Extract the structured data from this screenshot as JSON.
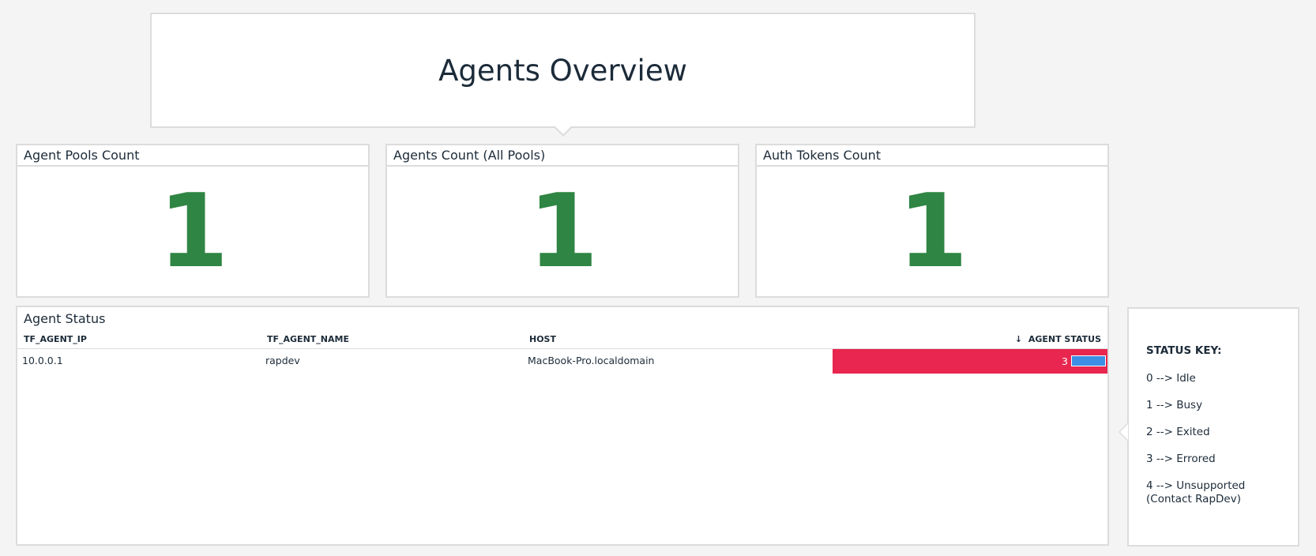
{
  "note": {
    "title": "Agents Overview"
  },
  "widgets": [
    {
      "title": "Agent Pools Count",
      "value": "1"
    },
    {
      "title": "Agents Count (All Pools)",
      "value": "1"
    },
    {
      "title": "Auth Tokens Count",
      "value": "1"
    }
  ],
  "agent_status": {
    "title": "Agent Status",
    "columns": [
      "TF_AGENT_IP",
      "TF_AGENT_NAME",
      "HOST",
      "AGENT STATUS"
    ],
    "sort_indicator": "↓",
    "rows": [
      {
        "ip": "10.0.0.1",
        "name": "rapdev",
        "host": "MacBook-Pro.localdomain",
        "status": "3",
        "status_fill": 1.0
      }
    ],
    "status_color": "#e8264f",
    "bar_color": "#3d8ee5"
  },
  "status_key": {
    "title": "STATUS KEY:",
    "items": [
      "0 --> Idle",
      "1 --> Busy",
      "2 --> Exited",
      "3 --> Errored",
      "4 --> Unsupported (Contact RapDev)"
    ]
  },
  "colors": {
    "value_green": "#2f8543"
  }
}
